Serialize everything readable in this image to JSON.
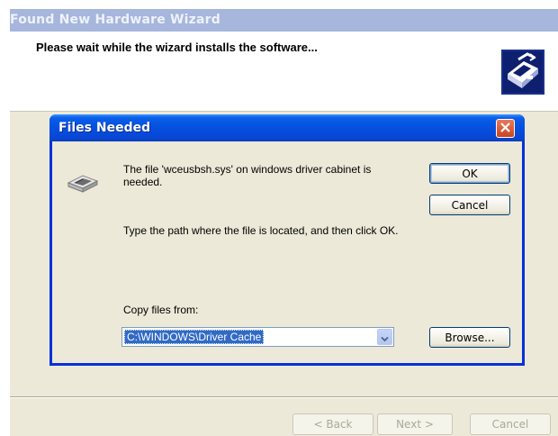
{
  "wizard": {
    "title": "Found New Hardware Wizard",
    "header_text": "Please wait while the wizard installs the software...",
    "buttons": {
      "back": "< Back",
      "next": "Next >",
      "cancel": "Cancel"
    }
  },
  "dialog": {
    "title": "Files Needed",
    "message": "The file 'wceusbsh.sys' on windows driver cabinet is needed.",
    "instruction": "Type the path where the file is located, and then click OK.",
    "copy_from_label": "Copy files from:",
    "copy_from_value": "C:\\WINDOWS\\Driver Cache",
    "buttons": {
      "ok": "OK",
      "cancel": "Cancel",
      "browse": "Browse..."
    }
  },
  "icons": {
    "close": "close-icon",
    "disk": "disk-drive-icon",
    "dropdown": "chevron-down-icon",
    "hardware": "hardware-wizard-icon"
  },
  "colors": {
    "dialog_title_bar": "#0550e0",
    "wizard_title_bar": "#a6b6dc",
    "selection": "#316ac5",
    "close_button": "#d8532c"
  }
}
